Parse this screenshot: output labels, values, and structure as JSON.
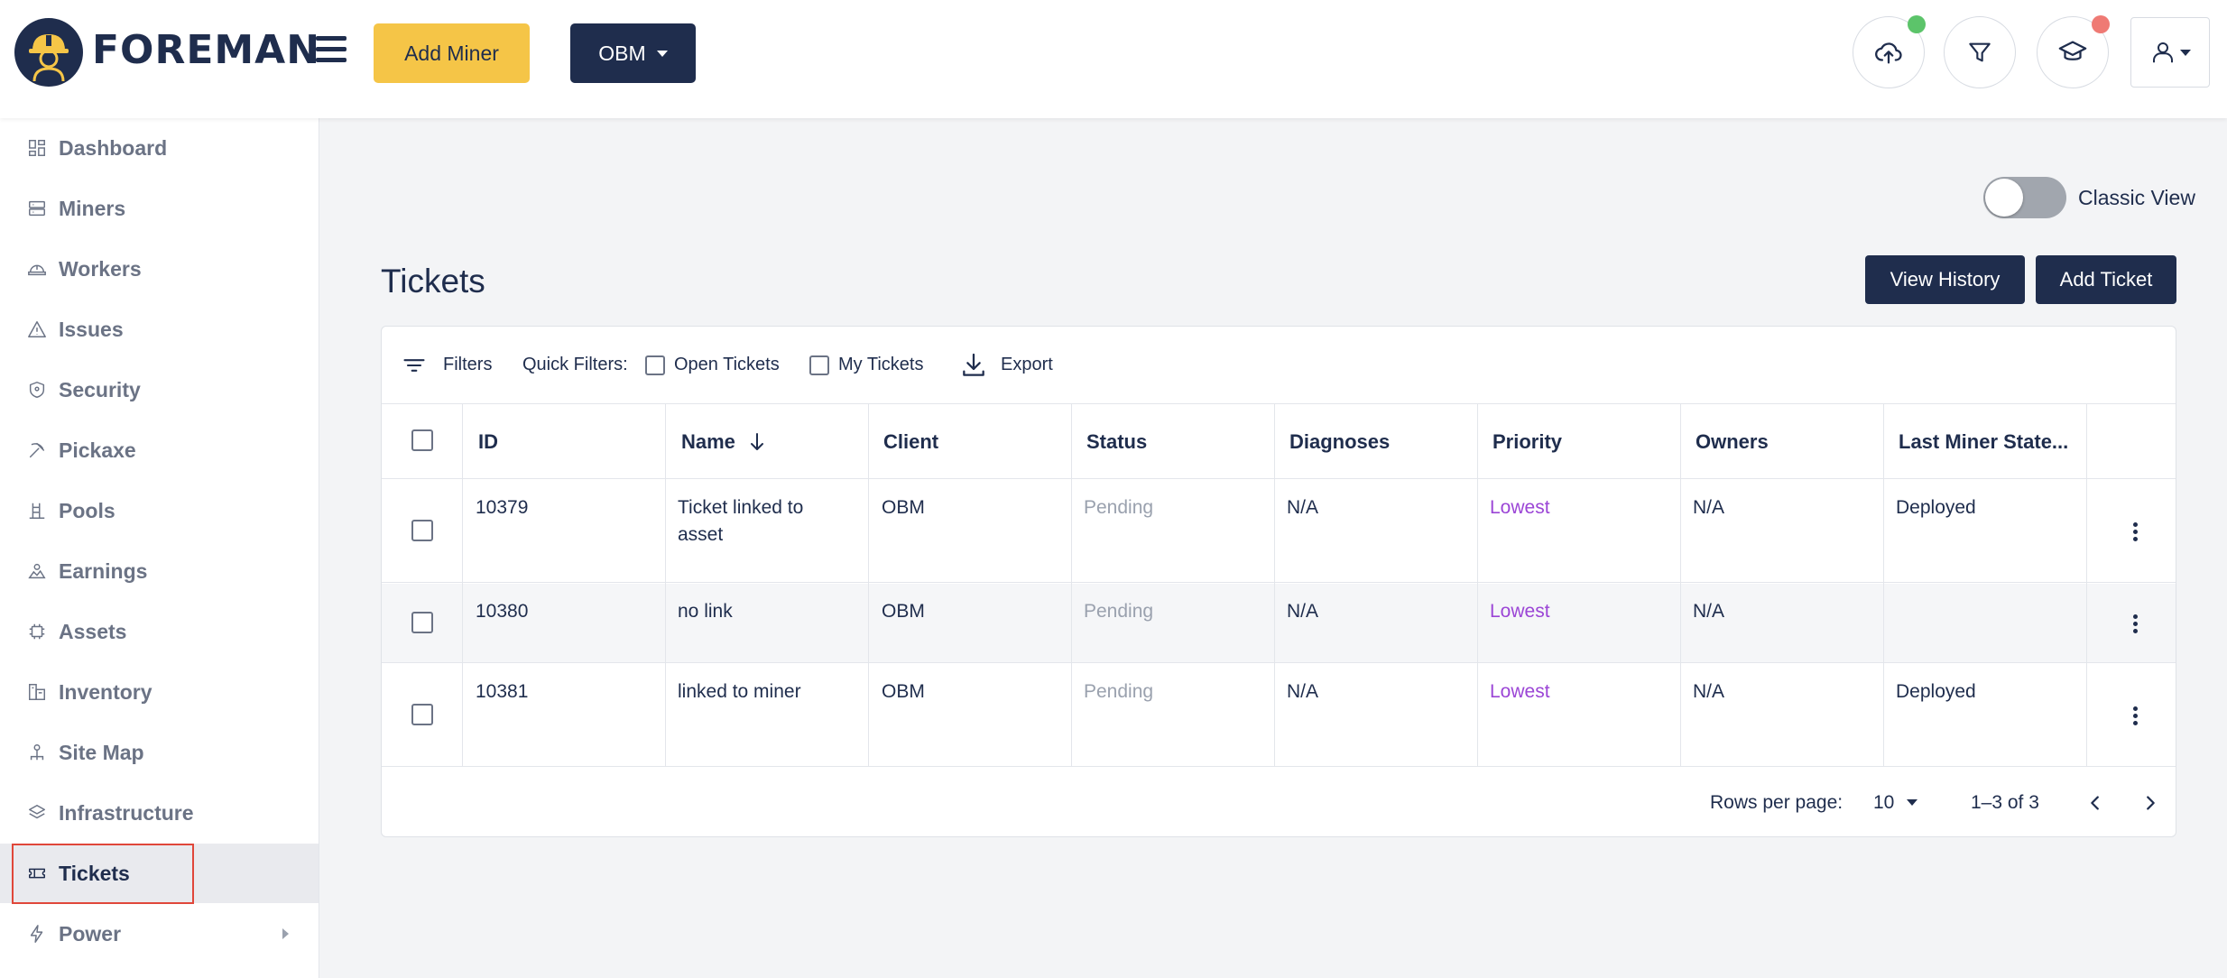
{
  "header": {
    "logo_text": "FOREMAN",
    "add_miner_label": "Add Miner",
    "client_select_label": "OBM",
    "status_colors": {
      "upload_dot": "#5cc46a",
      "academy_dot": "#ef7a74"
    }
  },
  "sidebar": {
    "items": [
      {
        "label": "Dashboard",
        "icon": "dashboard-icon"
      },
      {
        "label": "Miners",
        "icon": "miners-icon"
      },
      {
        "label": "Workers",
        "icon": "workers-icon"
      },
      {
        "label": "Issues",
        "icon": "warning-icon"
      },
      {
        "label": "Security",
        "icon": "shield-icon"
      },
      {
        "label": "Pickaxe",
        "icon": "pickaxe-icon"
      },
      {
        "label": "Pools",
        "icon": "pools-icon"
      },
      {
        "label": "Earnings",
        "icon": "earnings-icon"
      },
      {
        "label": "Assets",
        "icon": "chip-icon"
      },
      {
        "label": "Inventory",
        "icon": "inventory-icon"
      },
      {
        "label": "Site Map",
        "icon": "sitemap-icon"
      },
      {
        "label": "Infrastructure",
        "icon": "layers-icon"
      },
      {
        "label": "Tickets",
        "icon": "ticket-icon",
        "active": true
      },
      {
        "label": "Power",
        "icon": "lightning-icon"
      }
    ]
  },
  "main": {
    "classic_view_label": "Classic View",
    "title": "Tickets",
    "view_history_label": "View History",
    "add_ticket_label": "Add Ticket",
    "toolbar": {
      "filters_label": "Filters",
      "quick_filters_label": "Quick Filters:",
      "open_tickets_label": "Open Tickets",
      "my_tickets_label": "My Tickets",
      "export_label": "Export"
    },
    "columns": [
      "ID",
      "Name",
      "Client",
      "Status",
      "Diagnoses",
      "Priority",
      "Owners",
      "Last Miner State..."
    ],
    "rows": [
      {
        "id": "10379",
        "name": "Ticket linked to asset",
        "client": "OBM",
        "status": "Pending",
        "diagnoses": "N/A",
        "priority": "Lowest",
        "owners": "N/A",
        "last_state": "Deployed"
      },
      {
        "id": "10380",
        "name": "no link",
        "client": "OBM",
        "status": "Pending",
        "diagnoses": "N/A",
        "priority": "Lowest",
        "owners": "N/A",
        "last_state": ""
      },
      {
        "id": "10381",
        "name": "linked to miner",
        "client": "OBM",
        "status": "Pending",
        "diagnoses": "N/A",
        "priority": "Lowest",
        "owners": "N/A",
        "last_state": "Deployed"
      }
    ],
    "pagination": {
      "rows_per_page_label": "Rows per page:",
      "rows_per_page_value": "10",
      "range_label": "1–3 of 3"
    }
  }
}
